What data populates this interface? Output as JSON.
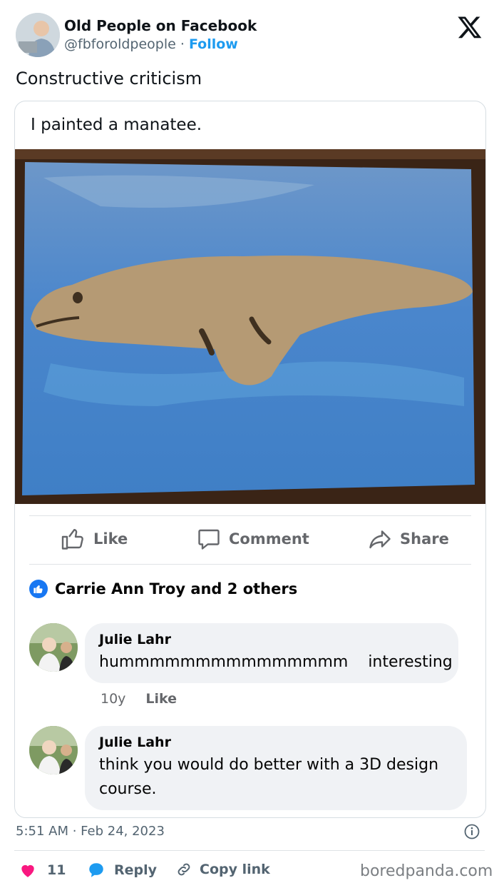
{
  "tweet": {
    "author_name": "Old People on Facebook",
    "handle": "@fbforoldpeople",
    "separator": "·",
    "follow_label": "Follow",
    "text": "Constructive criticism",
    "logo_icon": "x-logo-icon"
  },
  "fb_post": {
    "text": "I painted a manatee.",
    "image_icon": "manatee-painting",
    "actions": {
      "like": "Like",
      "comment": "Comment",
      "share": "Share"
    },
    "reactions": "Carrie Ann Troy and 2 others",
    "comments": [
      {
        "name": "Julie Lahr",
        "text": "hummmmmmmmmmmmmmm    interesting",
        "age": "10y",
        "like": "Like"
      },
      {
        "name": "Julie Lahr",
        "text": "think you would do better with a 3D design course."
      }
    ]
  },
  "footer": {
    "timestamp": "5:51 AM · Feb 24, 2023",
    "likes_count": "11",
    "reply_label": "Reply",
    "copy_link_label": "Copy link",
    "watermark": "boredpanda.com"
  },
  "colors": {
    "follow_blue": "#1d9bf0",
    "fb_blue": "#1877f2",
    "heart_pink": "#f91880",
    "water_blue": "#4f8fd0",
    "manatee_tan": "#b69a72"
  }
}
